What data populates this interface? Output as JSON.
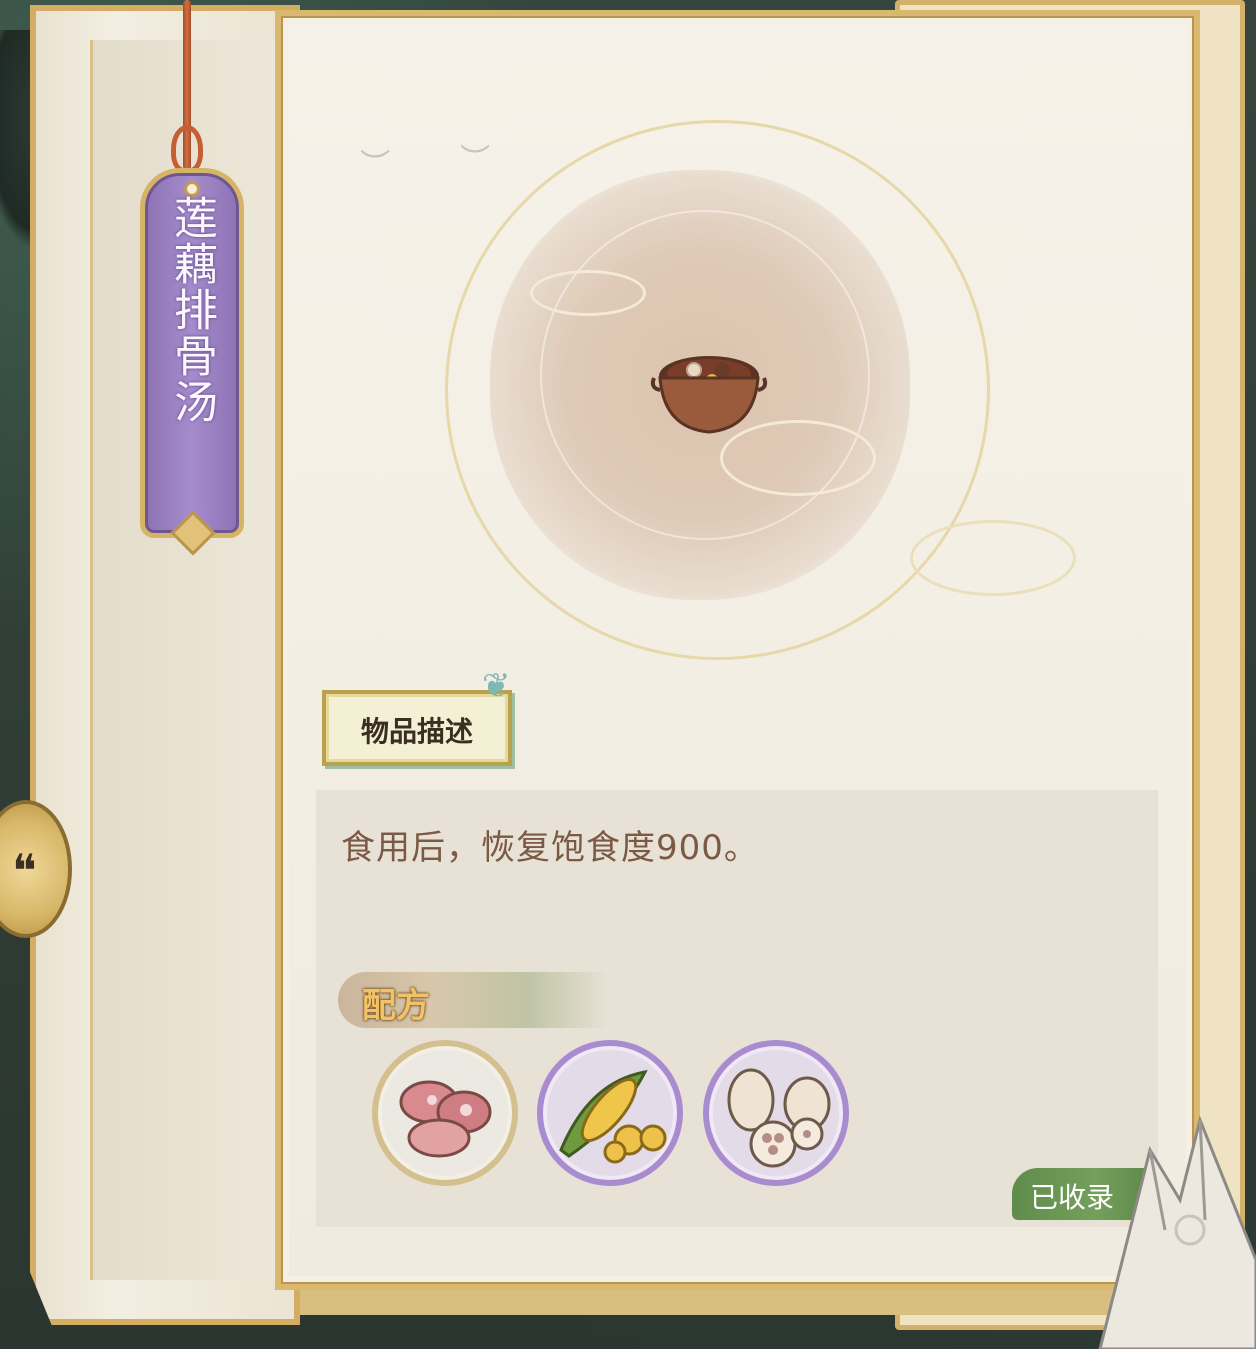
{
  "item": {
    "name": "莲藕排骨汤",
    "icon": "lotus-root-pork-rib-soup-pot"
  },
  "description": {
    "label": "物品描述",
    "text": "食用后，恢复饱食度900。"
  },
  "recipe": {
    "title": "配方",
    "ingredients": [
      {
        "icon": "pork-meat-icon"
      },
      {
        "icon": "corn-icon"
      },
      {
        "icon": "lotus-root-icon"
      }
    ]
  },
  "status": {
    "collected_label": "已收录"
  },
  "colors": {
    "tag_purple": "#9a80c2",
    "frame_gold": "#d8b96e",
    "collected_green": "#6a9756",
    "recipe_title_gold": "#f2c266"
  }
}
